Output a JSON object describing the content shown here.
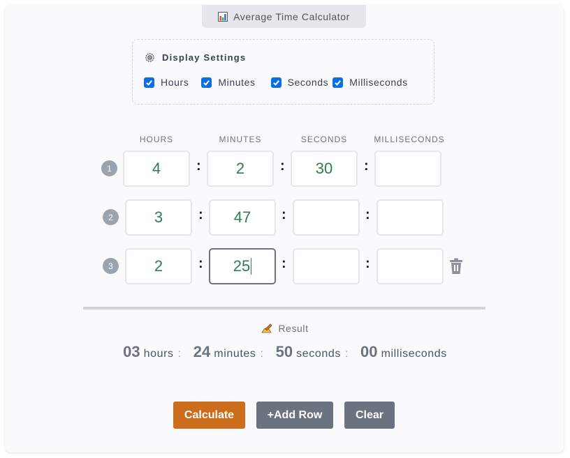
{
  "app": {
    "title": "Average Time Calculator",
    "title_icon": "bar-chart-icon"
  },
  "settings": {
    "heading": "Display Settings",
    "heading_icon": "gear-icon",
    "options": [
      {
        "label": "Hours",
        "checked": true
      },
      {
        "label": "Minutes",
        "checked": true
      },
      {
        "label": "Seconds",
        "checked": true
      },
      {
        "label": "Milliseconds",
        "checked": true
      }
    ]
  },
  "columns": [
    "HOURS",
    "MINUTES",
    "SECONDS",
    "MILLISECONDS"
  ],
  "separator": ":",
  "rows": [
    {
      "number": "1",
      "hours": "4",
      "minutes": "2",
      "seconds": "30",
      "milliseconds": ""
    },
    {
      "number": "2",
      "hours": "3",
      "minutes": "47",
      "seconds": "",
      "milliseconds": ""
    },
    {
      "number": "3",
      "hours": "2",
      "minutes": "25",
      "seconds": "",
      "milliseconds": "",
      "focused_field": "minutes",
      "delete_icon": "trash-icon"
    }
  ],
  "result": {
    "label": "Result",
    "label_icon": "writing-hand-icon",
    "hours": "03",
    "hours_unit": "hours",
    "minutes": "24",
    "minutes_unit": "minutes",
    "seconds": "50",
    "seconds_unit": "seconds",
    "milliseconds": "00",
    "milliseconds_unit": "milliseconds",
    "separator": ":"
  },
  "buttons": {
    "calculate": "Calculate",
    "add_row": "+Add Row",
    "clear": "Clear"
  },
  "colors": {
    "checkbox": "#0b6ee5",
    "input_value": "#2e7d4f",
    "calculate_button": "#cc6d1b",
    "secondary_button": "#6b7280"
  }
}
